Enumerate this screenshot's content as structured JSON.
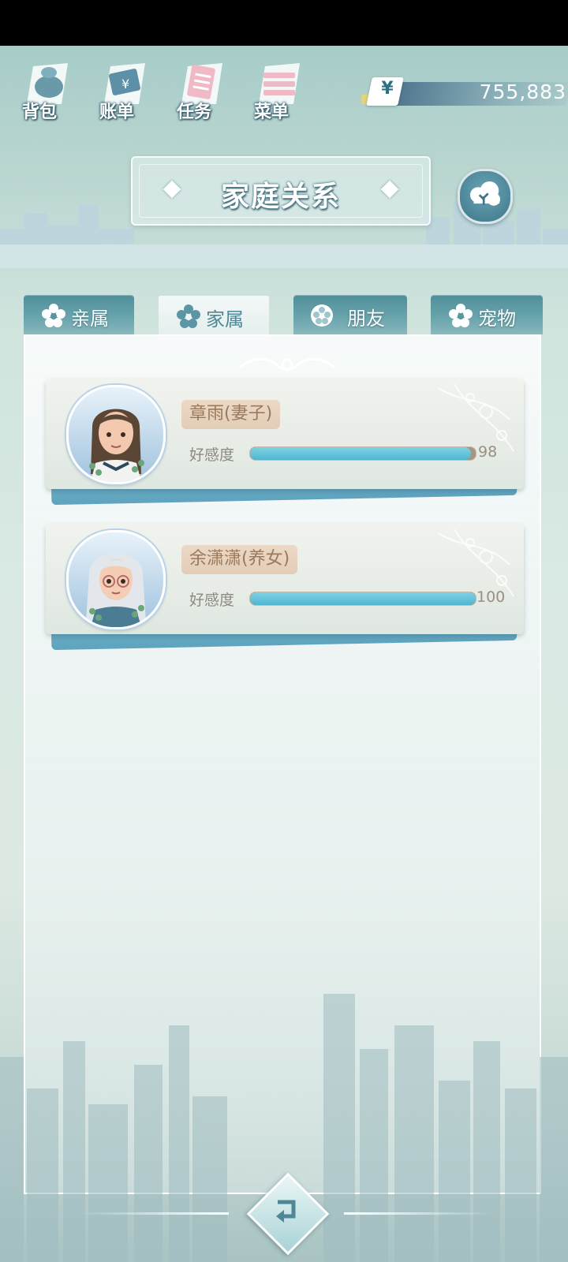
{
  "topbar": {
    "menu": [
      {
        "label": "背包",
        "icon": "bag-icon"
      },
      {
        "label": "账单",
        "icon": "bill-icon"
      },
      {
        "label": "任务",
        "icon": "task-icon"
      },
      {
        "label": "菜单",
        "icon": "menu-icon"
      }
    ],
    "currency_symbol": "¥",
    "money": "755,883"
  },
  "title": "家庭关系",
  "tabs": [
    {
      "label": "亲属",
      "active": false
    },
    {
      "label": "家属",
      "active": true
    },
    {
      "label": "朋友",
      "active": false
    },
    {
      "label": "宠物",
      "active": false
    }
  ],
  "members": [
    {
      "name": "章雨(妻子)",
      "affinity_label": "好感度",
      "affinity": 98,
      "affinity_max": 100
    },
    {
      "name": "余潇潇(养女)",
      "affinity_label": "好感度",
      "affinity": 100,
      "affinity_max": 100
    }
  ],
  "colors": {
    "accent": "#5bbdd4",
    "tab_inactive": "#5a96a0",
    "name_tag": "#e6d2bd"
  }
}
